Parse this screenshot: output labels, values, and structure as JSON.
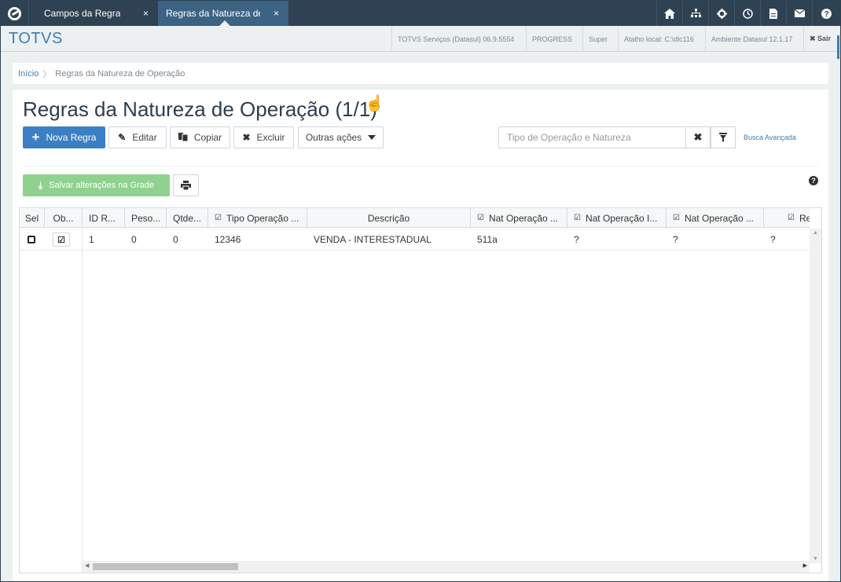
{
  "tabs": [
    {
      "label": "Campos da Regra",
      "close": "×"
    },
    {
      "label": "Regras da Natureza de Operação",
      "close": "×"
    }
  ],
  "top_icons": [
    "home-icon",
    "sitemap-icon",
    "gear-icon",
    "clock-icon",
    "file-icon",
    "mail-icon",
    "help-icon"
  ],
  "header": {
    "brand": "TOTVS",
    "product": "TOTVS Serviços (Datasul) 06.9.5554",
    "db": "PROGRESS",
    "user": "Super",
    "shortcut": "Atalho local: C:\\dlc116",
    "environment": "Ambiente Datasul 12.1.17",
    "exit": "✖ Sair"
  },
  "breadcrumb": {
    "home": "Início",
    "current": "Regras da Natureza de Operação"
  },
  "page": {
    "title": "Regras da Natureza de Operação (1/1)"
  },
  "toolbar": {
    "new": "Nova Regra",
    "edit": "Editar",
    "copy": "Copiar",
    "delete": "Excluir",
    "more": "Outras ações",
    "save_grid": "Salvar alterações na Grade"
  },
  "search": {
    "placeholder": "Tipo de Operação e Natureza",
    "advanced": "Busca Avançada"
  },
  "grid": {
    "columns": [
      "Sel",
      "Ob...",
      "ID R...",
      "Peso...",
      "Qtde...",
      "Tipo Operação ...",
      "Descrição",
      "Nat Operação ...",
      "Nat Operação I...",
      "Nat Operação ...",
      "Re"
    ],
    "rows": [
      {
        "id": "1",
        "peso": "0",
        "qtde": "0",
        "tipo": "12346",
        "descricao": "VENDA - INTERESTADUAL",
        "nat1": "511a",
        "nat2": "?",
        "nat3": "?",
        "re": "?"
      }
    ]
  },
  "colors": {
    "topbar": "#2f4254",
    "active_tab": "#3c6384",
    "primary": "#3b7fc4",
    "success": "#8fd28f",
    "brand": "#3b7fb6"
  }
}
